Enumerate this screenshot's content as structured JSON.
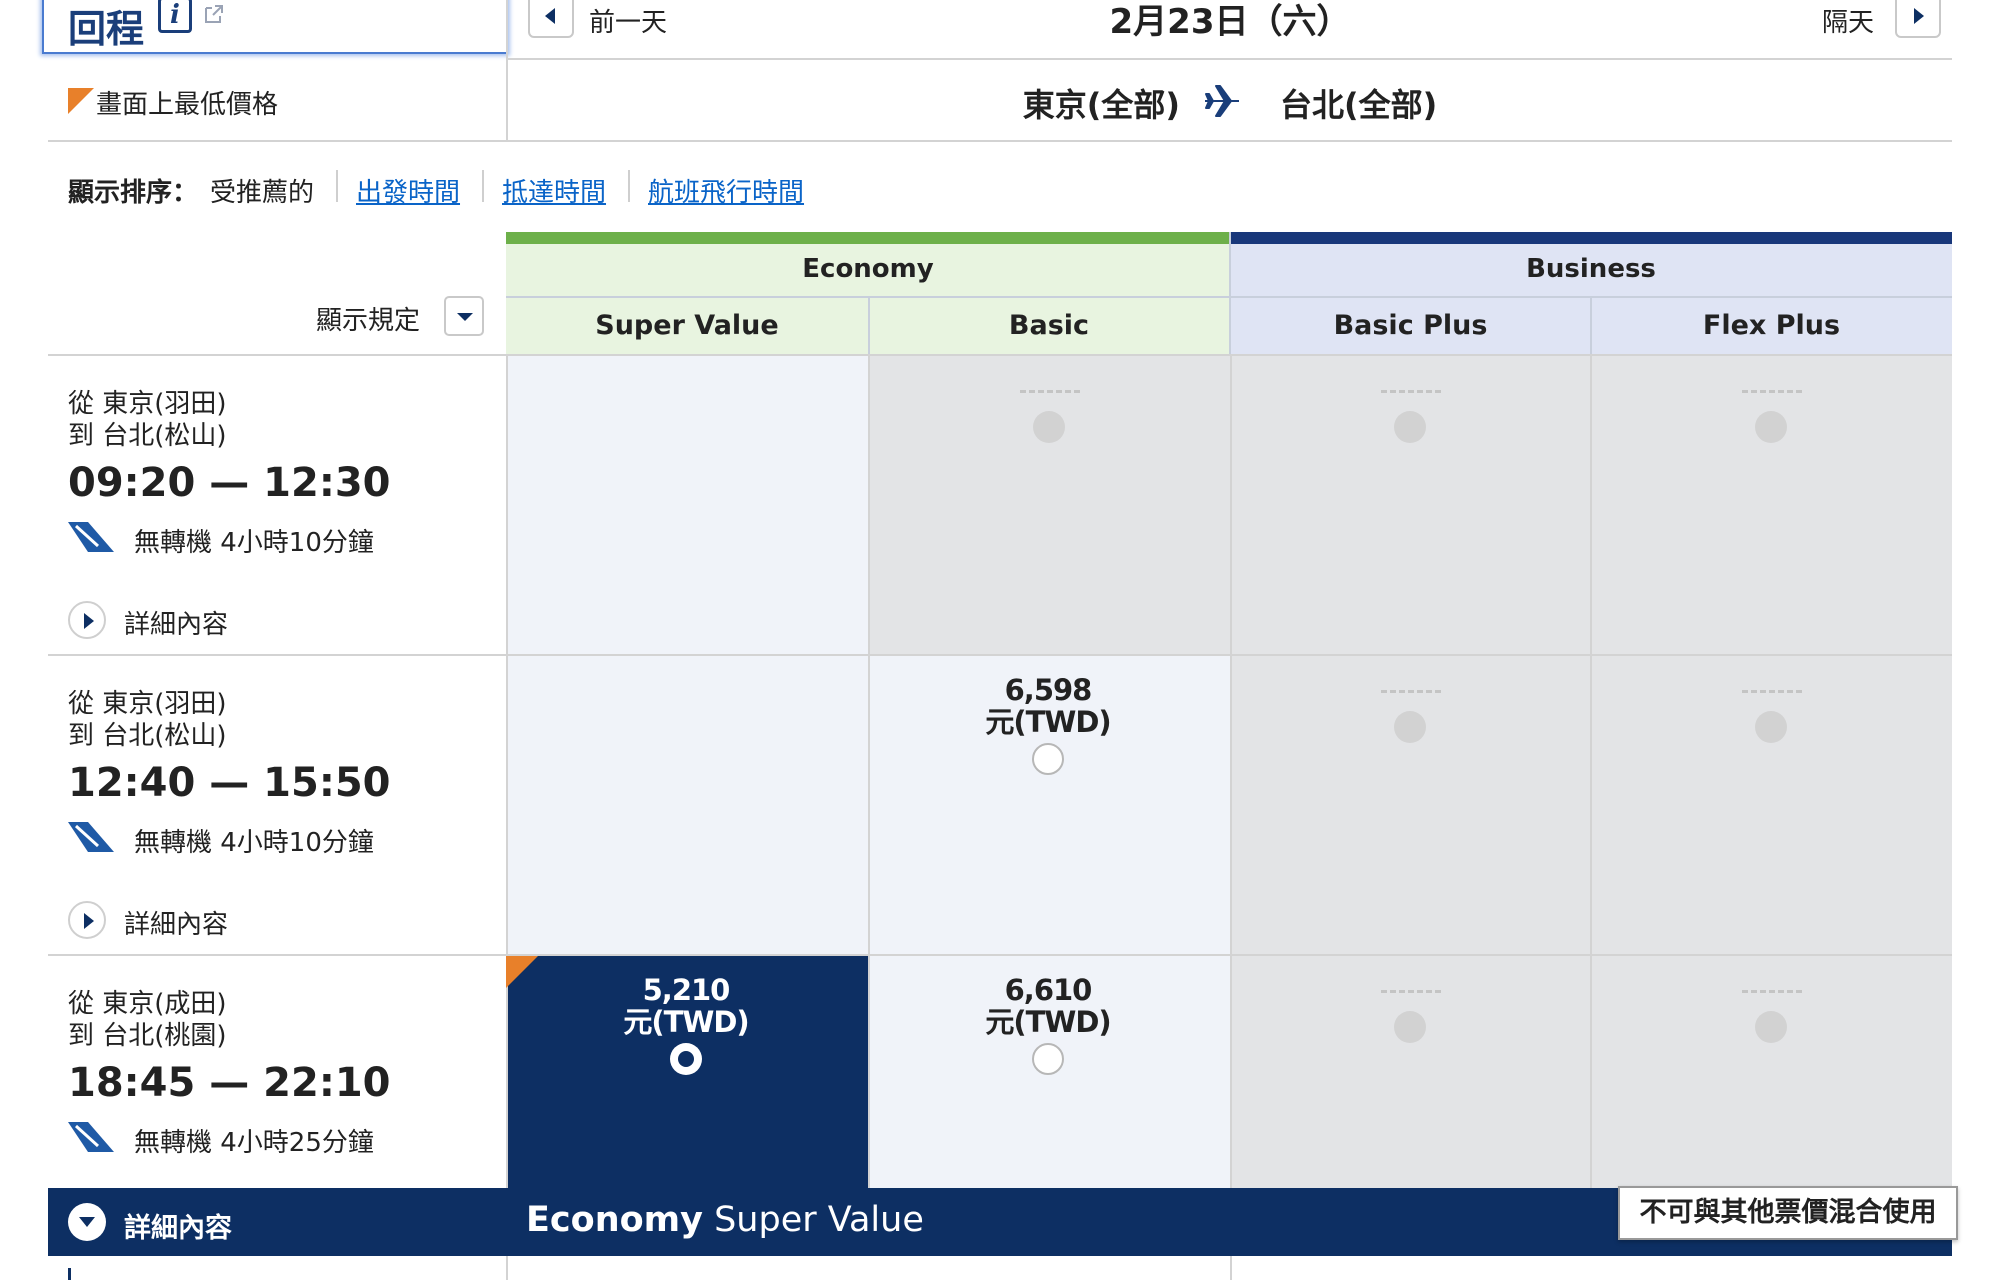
{
  "header": {
    "return_title": "回程",
    "info_icon": "i",
    "prev_day": "前一天",
    "next_day": "隔天",
    "date": "2月23日（六）",
    "lowest_price_legend": "畫面上最低價格",
    "route_from": "東京(全部)",
    "route_to": "台北(全部)"
  },
  "sort": {
    "label": "顯示排序：",
    "options": [
      "受推薦的",
      "出發時間",
      "抵達時間",
      "航班飛行時間"
    ]
  },
  "fare_table": {
    "rule_label": "顯示規定",
    "cabins": [
      {
        "name": "Economy",
        "color": "#6db04a",
        "fares": [
          "Super Value",
          "Basic"
        ]
      },
      {
        "name": "Business",
        "color": "#18377a",
        "fares": [
          "Basic Plus",
          "Flex Plus"
        ]
      }
    ],
    "na_mark": "---"
  },
  "flights": [
    {
      "from": "從 東京(羽田)",
      "to": "到 台北(松山)",
      "time": "09:20 — 12:30",
      "stops": "無轉機 4小時10分鐘",
      "details": "詳細內容",
      "fares": [
        null,
        "na",
        "na",
        "na"
      ]
    },
    {
      "from": "從 東京(羽田)",
      "to": "到 台北(松山)",
      "time": "12:40 — 15:50",
      "stops": "無轉機 4小時10分鐘",
      "details": "詳細內容",
      "fares": [
        null,
        {
          "amount": "6,598",
          "currency": "元(TWD)"
        },
        "na",
        "na"
      ]
    },
    {
      "from": "從 東京(成田)",
      "to": "到 台北(桃園)",
      "time": "18:45 — 22:10",
      "stops": "無轉機 4小時25分鐘",
      "details": "詳細內容",
      "fares": [
        {
          "amount": "5,210",
          "currency": "元(TWD)",
          "selected": true,
          "lowest": true
        },
        {
          "amount": "6,610",
          "currency": "元(TWD)"
        },
        "na",
        "na"
      ]
    }
  ],
  "selected": {
    "details": "詳細內容",
    "fare_bold": "Economy",
    "fare_rest": " Super Value",
    "note": "不可與其他票價混合使用"
  },
  "colors": {
    "accent_navy": "#0d2f63",
    "link": "#0a64c8",
    "lowest_flag": "#e8802a"
  }
}
